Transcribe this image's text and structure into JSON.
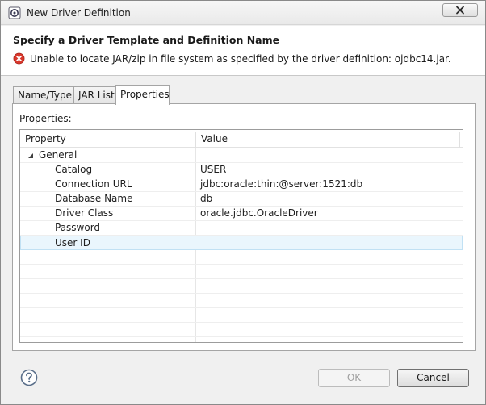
{
  "window": {
    "title": "New Driver Definition"
  },
  "header": {
    "title": "Specify a Driver Template and Definition Name",
    "error_message": "Unable to locate JAR/zip in file system as specified by the driver definition: ojdbc14.jar."
  },
  "tabs": [
    {
      "label": "Name/Type",
      "active": false
    },
    {
      "label": "JAR List",
      "active": false
    },
    {
      "label": "Properties",
      "active": true
    }
  ],
  "properties_panel": {
    "label": "Properties:",
    "columns": [
      "Property",
      "Value"
    ],
    "group": "General",
    "rows": [
      {
        "property": "Catalog",
        "value": "USER"
      },
      {
        "property": "Connection URL",
        "value": "jdbc:oracle:thin:@server:1521:db"
      },
      {
        "property": "Database Name",
        "value": "db"
      },
      {
        "property": "Driver Class",
        "value": "oracle.jdbc.OracleDriver"
      },
      {
        "property": "Password",
        "value": ""
      },
      {
        "property": "User ID",
        "value": ""
      }
    ]
  },
  "buttons": {
    "ok": "OK",
    "cancel": "Cancel"
  },
  "colors": {
    "error_red": "#d9382c",
    "selection": "#eaf6fd",
    "help_blue": "#5a6f8a"
  }
}
